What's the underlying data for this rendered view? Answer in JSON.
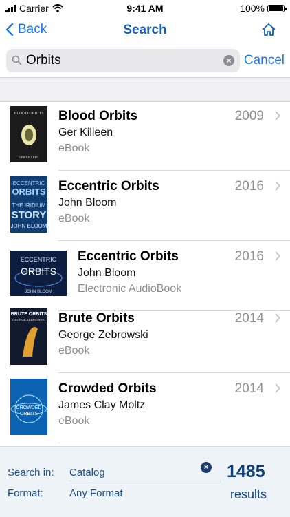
{
  "status_bar": {
    "carrier": "Carrier",
    "time": "9:41 AM",
    "battery": "100%"
  },
  "nav": {
    "back_label": "Back",
    "title": "Search"
  },
  "search": {
    "query": "Orbits",
    "cancel_label": "Cancel"
  },
  "results": [
    {
      "title": "Blood Orbits",
      "author": "Ger Killeen",
      "format": "eBook",
      "year": "2009",
      "cover_text": [
        "BLOOD ORBITS",
        "GER KILLEEN"
      ],
      "cover_colors": [
        "#1b1b1b",
        "#e8e2a6"
      ]
    },
    {
      "title": "Eccentric Orbits",
      "author": "John Bloom",
      "format": "eBook",
      "year": "2016",
      "cover_text": [
        "ECCENTRIC",
        "ORBITS",
        "THE IRIDIUM",
        "STORY",
        "JOHN BLOOM"
      ],
      "cover_colors": [
        "#0f3d74",
        "#9fd0f5"
      ]
    },
    {
      "title": "Eccentric Orbits",
      "author": "John Bloom",
      "format": "Electronic AudioBook",
      "year": "2016",
      "cover_text": [
        "ECCENTRIC",
        "ORBITS",
        "JOHN BLOOM"
      ],
      "cover_colors": [
        "#0c1d40",
        "#4f86d4"
      ]
    },
    {
      "title": "Brute Orbits",
      "author": "George Zebrowski",
      "format": "eBook",
      "year": "2014",
      "cover_text": [
        "BRUTE ORBITS",
        "GEORGE ZEBROWSKI"
      ],
      "cover_colors": [
        "#121a2e",
        "#e0a030"
      ]
    },
    {
      "title": "Crowded Orbits",
      "author": "James Clay Moltz",
      "format": "eBook",
      "year": "2014",
      "cover_text": [
        "CROWDED",
        "ORBITS"
      ],
      "cover_colors": [
        "#0a62b0",
        "#bfe6ff"
      ]
    }
  ],
  "footer": {
    "search_in_label": "Search in:",
    "search_in_value": "Catalog",
    "format_label": "Format:",
    "format_value": "Any Format",
    "result_count": "1485",
    "result_count_label": "results"
  },
  "colors": {
    "accent": "#1a7ae8",
    "title": "#1560b5",
    "footer_bg": "#eef3f8",
    "count": "#0e3f76"
  }
}
